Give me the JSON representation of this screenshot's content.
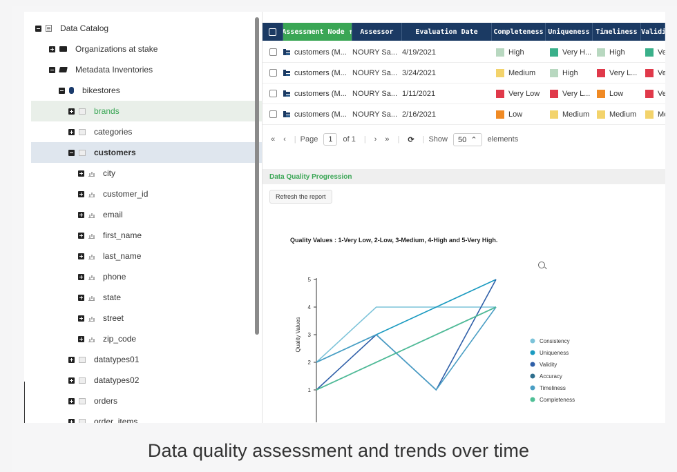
{
  "caption": "Data quality assessment and trends over time",
  "tree": {
    "items": [
      {
        "label": "Data Catalog",
        "toggle": "minus",
        "icon": "doc",
        "style": ""
      },
      {
        "label": "Organizations at stake",
        "toggle": "plus",
        "icon": "folder",
        "style": ""
      },
      {
        "label": "Metadata Inventories",
        "toggle": "minus",
        "icon": "folder-open",
        "style": ""
      },
      {
        "label": "bikestores",
        "toggle": "minus",
        "icon": "db",
        "style": ""
      },
      {
        "label": "brands",
        "toggle": "plus",
        "icon": "table",
        "style": "green"
      },
      {
        "label": "categories",
        "toggle": "plus",
        "icon": "table",
        "style": ""
      },
      {
        "label": "customers",
        "toggle": "minus",
        "icon": "table",
        "style": "blue"
      },
      {
        "label": "city",
        "toggle": "plus",
        "icon": "col",
        "style": ""
      },
      {
        "label": "customer_id",
        "toggle": "plus",
        "icon": "col",
        "style": ""
      },
      {
        "label": "email",
        "toggle": "plus",
        "icon": "col",
        "style": ""
      },
      {
        "label": "first_name",
        "toggle": "plus",
        "icon": "col",
        "style": ""
      },
      {
        "label": "last_name",
        "toggle": "plus",
        "icon": "col",
        "style": ""
      },
      {
        "label": "phone",
        "toggle": "plus",
        "icon": "col",
        "style": ""
      },
      {
        "label": "state",
        "toggle": "plus",
        "icon": "col",
        "style": ""
      },
      {
        "label": "street",
        "toggle": "plus",
        "icon": "col",
        "style": ""
      },
      {
        "label": "zip_code",
        "toggle": "plus",
        "icon": "col",
        "style": ""
      },
      {
        "label": "datatypes01",
        "toggle": "plus",
        "icon": "table",
        "style": ""
      },
      {
        "label": "datatypes02",
        "toggle": "plus",
        "icon": "table",
        "style": ""
      },
      {
        "label": "orders",
        "toggle": "plus",
        "icon": "table",
        "style": ""
      },
      {
        "label": "order_items",
        "toggle": "plus",
        "icon": "table",
        "style": ""
      }
    ]
  },
  "table": {
    "headers": [
      "Assessment Node ↑",
      "Assessor",
      "Evaluation Date",
      "Completeness",
      "Uniqueness",
      "Timeliness",
      "Validi"
    ],
    "rows": [
      {
        "node": "customers (M...",
        "assessor": "NOURY Sa...",
        "date": "4/19/2021",
        "q": [
          {
            "t": "High",
            "c": "#b8d8c0"
          },
          {
            "t": "Very H...",
            "c": "#3ab08a"
          },
          {
            "t": "High",
            "c": "#b8d8c0"
          },
          {
            "t": "Ver",
            "c": "#3ab08a"
          }
        ]
      },
      {
        "node": "customers (M...",
        "assessor": "NOURY Sa...",
        "date": "3/24/2021",
        "q": [
          {
            "t": "Medium",
            "c": "#f3d36b"
          },
          {
            "t": "High",
            "c": "#b8d8c0"
          },
          {
            "t": "Very L...",
            "c": "#e0394a"
          },
          {
            "t": "Ver",
            "c": "#e0394a"
          }
        ]
      },
      {
        "node": "customers (M...",
        "assessor": "NOURY Sa...",
        "date": "1/11/2021",
        "q": [
          {
            "t": "Very Low",
            "c": "#e0394a"
          },
          {
            "t": "Very L...",
            "c": "#e0394a"
          },
          {
            "t": "Low",
            "c": "#f08a24"
          },
          {
            "t": "Ver",
            "c": "#e0394a"
          }
        ]
      },
      {
        "node": "customers (M...",
        "assessor": "NOURY Sa...",
        "date": "2/16/2021",
        "q": [
          {
            "t": "Low",
            "c": "#f08a24"
          },
          {
            "t": "Medium",
            "c": "#f3d36b"
          },
          {
            "t": "Medium",
            "c": "#f3d36b"
          },
          {
            "t": "Me",
            "c": "#f3d36b"
          }
        ]
      }
    ]
  },
  "pager": {
    "page_label": "Page",
    "page": "1",
    "of": "of 1",
    "show": "Show",
    "per_page": "50",
    "elements": "elements"
  },
  "section": {
    "title": "Data Quality Progression",
    "refresh": "Refresh the report",
    "quality_note": "Quality Values : 1-Very Low, 2-Low, 3-Medium, 4-High and 5-Very High."
  },
  "chart_data": {
    "type": "line",
    "ylabel": "Quality Values",
    "ylim": [
      0,
      5
    ],
    "yticks": [
      1,
      2,
      3,
      4,
      5
    ],
    "x": [
      1,
      2,
      3,
      4
    ],
    "legend_position": "right",
    "series": [
      {
        "name": "Consistency",
        "color": "#7cc3d9",
        "values": [
          2,
          4,
          4,
          4
        ]
      },
      {
        "name": "Uniqueness",
        "color": "#1a9ac0",
        "values": [
          2,
          3,
          4,
          5
        ]
      },
      {
        "name": "Validity",
        "color": "#2f5fa8",
        "values": [
          1,
          3,
          1,
          5
        ]
      },
      {
        "name": "Accuracy",
        "color": "#2e6f8e",
        "values": [
          1,
          2,
          3,
          4
        ]
      },
      {
        "name": "Timeliness",
        "color": "#4a9ec4",
        "values": [
          2,
          3,
          1,
          4
        ]
      },
      {
        "name": "Completeness",
        "color": "#4fbf96",
        "values": [
          1,
          2,
          3,
          4
        ]
      }
    ]
  }
}
